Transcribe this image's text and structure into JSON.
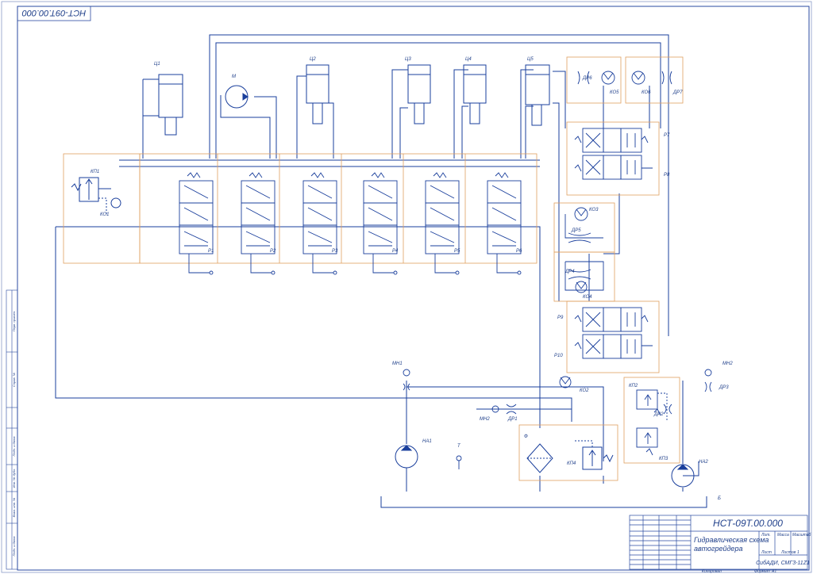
{
  "drawing": {
    "code_stamp": "НСТ-09Т.00.000",
    "title_line1": "Гидравлическая схема",
    "title_line2": "автогрейдера",
    "designation": "НСТ-09Т.00.000",
    "organization": "СибАДИ, СМГ3-11Z1",
    "sheet_label": "Лист",
    "sheets_label": "Листов",
    "sheets_count": "1",
    "scale_label": "Масштаб",
    "mass_label": "Масса",
    "lit_label": "Лит.",
    "copied_label": "Копировал",
    "format_label": "Формат",
    "format_value": "A1"
  },
  "left_strip": [
    "Перв. примен.",
    "Справ. №",
    "Подп. и дата",
    "Инв. № дубл.",
    "Взам. инв. №",
    "Подп. и дата",
    "Инв. № подл."
  ],
  "labels": {
    "c1": "Ц1",
    "m": "М",
    "c2": "Ц2",
    "c3": "Ц3",
    "c4": "Ц4",
    "c5": "Ц5",
    "kp1": "КП1",
    "ko1": "КО1",
    "p1": "Р1",
    "p2": "Р2",
    "p3": "Р3",
    "p4": "Р4",
    "p5": "Р5",
    "p6": "Р6",
    "dr6": "ДР6",
    "ko5": "КО5",
    "ko6": "КО6",
    "dr7": "ДР7",
    "p7": "Р7",
    "p8": "Р8",
    "ko3": "КО3",
    "dr5": "ДР5",
    "dr4": "ДР4",
    "ko4": "КО4",
    "p9": "Р9",
    "p10": "Р10",
    "mn1": "МН1",
    "mn2": "МН2",
    "mn2b": "МН2",
    "ko2": "КО2",
    "dr1": "ДР1",
    "kp2": "КП2",
    "dr2": "ДР2",
    "kp3": "КП3",
    "dr3": "ДР3",
    "na1": "НА1",
    "t": "Т",
    "f": "Ф",
    "kp4": "КП4",
    "na2": "НА2",
    "b": "Б"
  },
  "colors": {
    "line": "#1a3f9c",
    "frame": "#2a4aa0",
    "group_border": "#e0a060"
  }
}
